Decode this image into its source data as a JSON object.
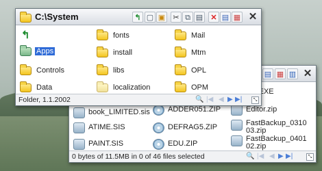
{
  "colors": {
    "selection": "#2f6bd7",
    "titlebar": "#e6e9ee",
    "nav_active": "#4c7ed6"
  },
  "front_window": {
    "title": "C:\\System",
    "toolbar_icons": [
      "up-arrow-icon",
      "view-icon",
      "properties-icon",
      "cut-icon",
      "copy-icon",
      "paste-icon",
      "delete-icon",
      "details-icon",
      "list-view-icon",
      "icon-view-icon"
    ],
    "close_glyph": "✕",
    "up_glyph": "⮬",
    "items": [
      {
        "label": "fonts",
        "icon": "folder-icon"
      },
      {
        "label": "Mail",
        "icon": "folder-icon"
      },
      {
        "label": "Apps",
        "icon": "folder-icon",
        "selected": true
      },
      {
        "label": "install",
        "icon": "folder-icon"
      },
      {
        "label": "Mtm",
        "icon": "folder-icon"
      },
      {
        "label": "Controls",
        "icon": "folder-icon"
      },
      {
        "label": "libs",
        "icon": "folder-icon"
      },
      {
        "label": "OPL",
        "icon": "folder-icon"
      },
      {
        "label": "Data",
        "icon": "folder-icon"
      },
      {
        "label": "localization",
        "icon": "folder-icon"
      },
      {
        "label": "OPM",
        "icon": "folder-icon"
      }
    ],
    "status": "Folder, 1.1.2002"
  },
  "back_window": {
    "close_glyph": "✕",
    "items": [
      {
        "label": "ELL.EXE"
      },
      {
        "label": "book_LIMITED.sis"
      },
      {
        "label": "ADDER051.ZIP"
      },
      {
        "label": "Editor.zip"
      },
      {
        "label": "ATIME.SIS"
      },
      {
        "label": "DEFRAG5.ZIP"
      },
      {
        "label": "FastBackup_0310\n03.zip"
      },
      {
        "label": "PAINT.SIS"
      },
      {
        "label": "EDU.ZIP"
      },
      {
        "label": "FastBackup_0401\n02.zip"
      }
    ],
    "status": "0 bytes of 11.5MB in 0 of 46 files selected"
  },
  "nav": {
    "first": "|◀",
    "prev": "◀",
    "next": "▶",
    "last": "▶|",
    "search": "🔍",
    "grip": "⤡"
  }
}
